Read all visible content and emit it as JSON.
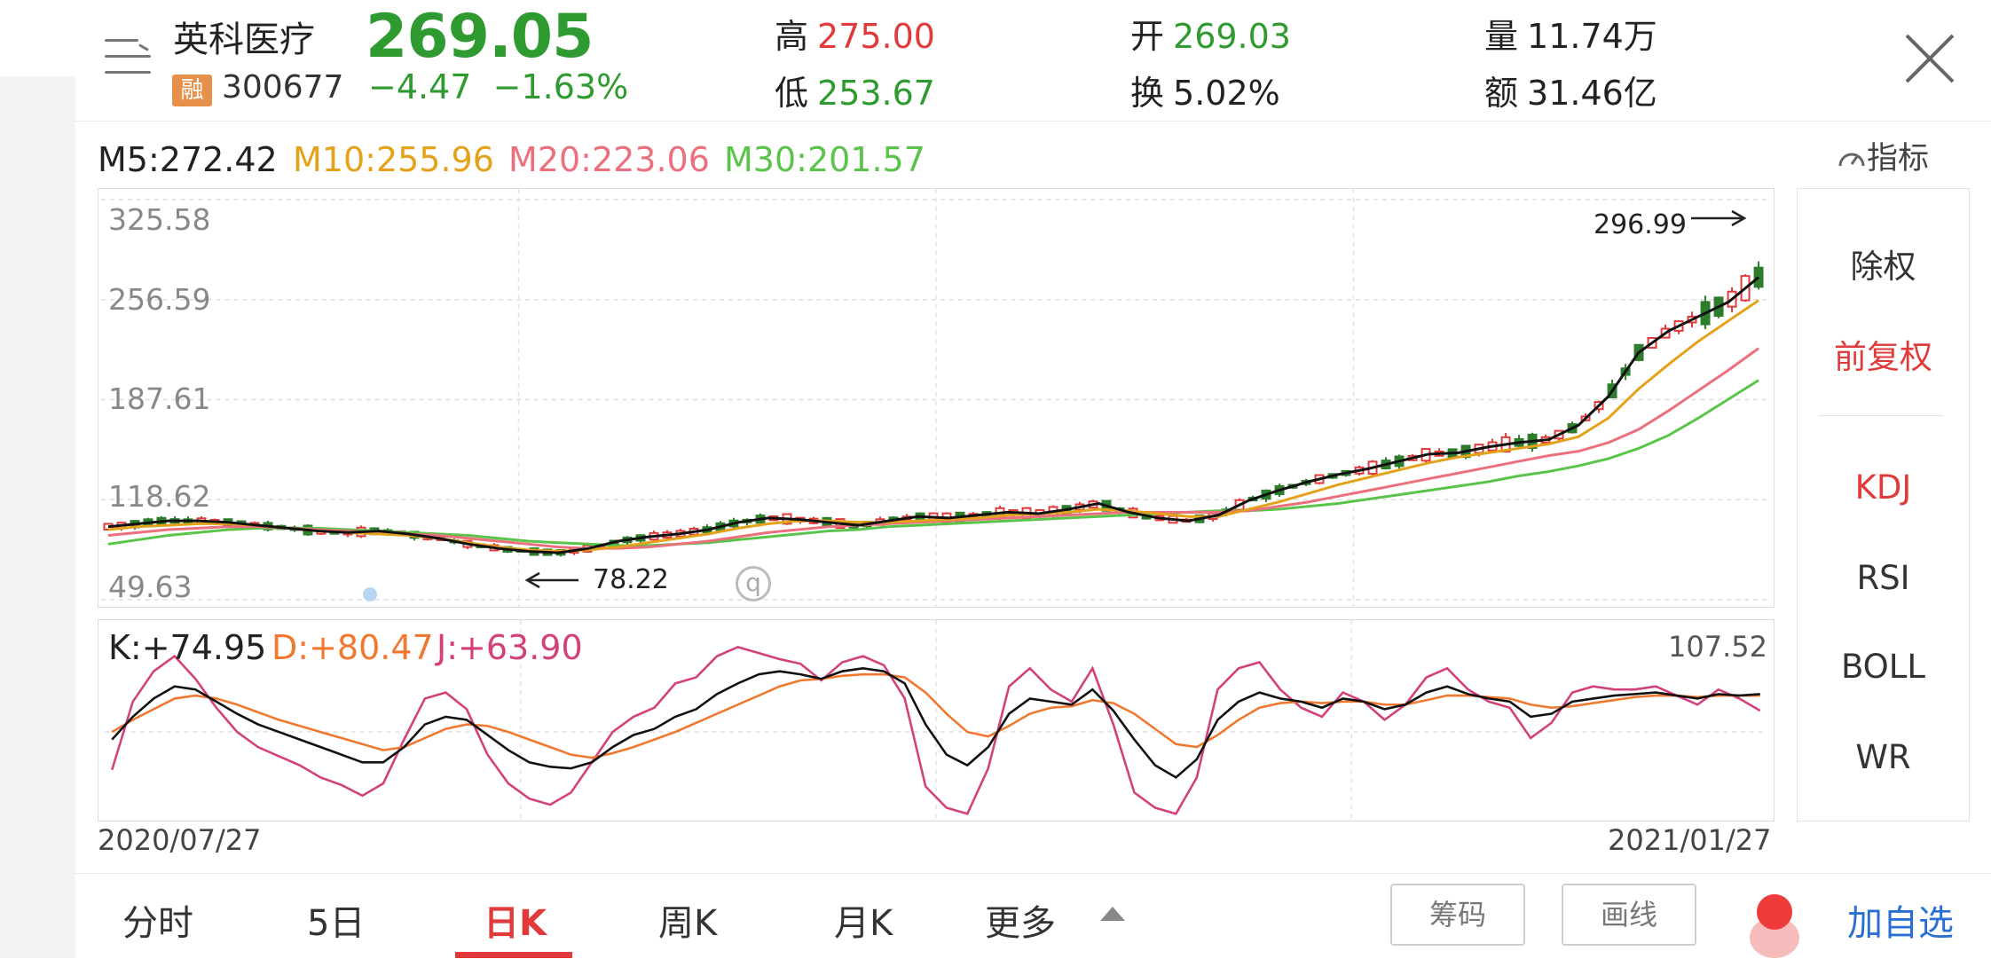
{
  "header": {
    "name": "英科医疗",
    "badge": "融",
    "code": "300677",
    "price": "269.05",
    "change": "−4.47",
    "change_pct": "−1.63%",
    "high_label": "高",
    "high": "275.00",
    "low_label": "低",
    "low": "253.67",
    "open_label": "开",
    "open": "269.03",
    "turnover_label": "换",
    "turnover": "5.02%",
    "volume_label": "量",
    "volume": "11.74万",
    "amount_label": "额",
    "amount": "31.46亿",
    "colors": {
      "up": "#e03a3a",
      "down": "#2f9a2f"
    }
  },
  "ma_legend": {
    "m5": "M5:272.42",
    "m10": "M10:255.96",
    "m20": "M20:223.06",
    "m30": "M30:201.57"
  },
  "indicator_button": "指标",
  "main_chart": {
    "y_ticks": [
      "325.58",
      "256.59",
      "187.61",
      "118.62",
      "49.63"
    ],
    "max_annotation": "296.99",
    "min_annotation": "78.22",
    "watermark": "q"
  },
  "kdj": {
    "k": "K:+74.95",
    "d": "D:+80.47",
    "j": "J:+63.90",
    "max": "107.52"
  },
  "dates": {
    "start": "2020/07/27",
    "end": "2021/01/27"
  },
  "side_panel": {
    "items": [
      "除权",
      "前复权",
      "KDJ",
      "RSI",
      "BOLL",
      "WR"
    ]
  },
  "tabs": [
    "分时",
    "5日",
    "日K",
    "周K",
    "月K",
    "更多"
  ],
  "active_tab": "日K",
  "buttons": {
    "chips": "筹码",
    "draw": "画线",
    "add_watch": "加自选"
  },
  "chart_data": [
    {
      "type": "candlestick",
      "x_range": [
        "2020/07/27",
        "2021/01/27"
      ],
      "ylim": [
        49.63,
        325.58
      ],
      "y_ticks": [
        325.58,
        256.59,
        187.61,
        118.62,
        49.63
      ],
      "series": [
        {
          "name": "M5",
          "value": 272.42,
          "color": "#111111",
          "values": [
            100,
            102,
            104,
            104,
            103,
            101,
            99,
            97,
            96,
            97,
            95,
            92,
            88,
            85,
            83,
            82,
            85,
            90,
            93,
            95,
            98,
            103,
            106,
            105,
            103,
            101,
            104,
            107,
            106,
            108,
            110,
            109,
            112,
            116,
            110,
            106,
            104,
            108,
            118,
            125,
            131,
            136,
            140,
            145,
            150,
            151,
            155,
            158,
            160,
            170,
            190,
            220,
            235,
            245,
            255,
            272
          ]
        },
        {
          "name": "M10",
          "value": 255.96,
          "color": "#e3a21a",
          "values": [
            98,
            100,
            101,
            102,
            102,
            101,
            99,
            97,
            96,
            95,
            94,
            92,
            89,
            86,
            84,
            83,
            84,
            86,
            89,
            92,
            95,
            99,
            102,
            104,
            104,
            103,
            103,
            104,
            105,
            106,
            108,
            109,
            110,
            112,
            111,
            109,
            107,
            107,
            112,
            117,
            123,
            129,
            134,
            139,
            144,
            148,
            151,
            154,
            157,
            162,
            175,
            195,
            212,
            228,
            242,
            256
          ]
        },
        {
          "name": "M20",
          "value": 223.06,
          "color": "#ec6f7d",
          "values": [
            94,
            96,
            98,
            99,
            100,
            100,
            99,
            98,
            97,
            96,
            95,
            94,
            92,
            90,
            88,
            86,
            85,
            85,
            86,
            88,
            90,
            93,
            96,
            98,
            100,
            101,
            102,
            103,
            104,
            105,
            106,
            107,
            108,
            109,
            110,
            110,
            110,
            110,
            111,
            114,
            117,
            121,
            125,
            129,
            133,
            137,
            141,
            145,
            149,
            152,
            158,
            167,
            180,
            194,
            208,
            223
          ]
        },
        {
          "name": "M30",
          "value": 201.57,
          "color": "#5ac44a",
          "values": [
            88,
            91,
            94,
            96,
            98,
            99,
            99,
            99,
            98,
            97,
            96,
            95,
            94,
            92,
            90,
            89,
            88,
            87,
            87,
            88,
            89,
            91,
            93,
            95,
            97,
            98,
            100,
            101,
            102,
            103,
            104,
            105,
            106,
            107,
            108,
            109,
            110,
            111,
            111,
            112,
            114,
            116,
            119,
            122,
            125,
            128,
            131,
            135,
            138,
            142,
            147,
            154,
            163,
            175,
            188,
            201
          ]
        }
      ],
      "annotations": {
        "max": 296.99,
        "min": 78.22
      }
    },
    {
      "type": "line",
      "title": "KDJ",
      "ylim": [
        -5,
        107.52
      ],
      "series": [
        {
          "name": "K",
          "value": 74.95,
          "color": "#111111",
          "values": [
            45,
            60,
            72,
            80,
            78,
            70,
            62,
            55,
            50,
            45,
            40,
            35,
            30,
            30,
            40,
            55,
            60,
            58,
            48,
            38,
            30,
            27,
            26,
            30,
            40,
            48,
            52,
            60,
            65,
            75,
            82,
            88,
            90,
            88,
            85,
            90,
            92,
            90,
            82,
            55,
            35,
            28,
            40,
            62,
            72,
            70,
            68,
            78,
            64,
            45,
            28,
            20,
            32,
            58,
            70,
            76,
            72,
            70,
            66,
            72,
            70,
            65,
            68,
            76,
            80,
            75,
            72,
            70,
            60,
            62,
            70,
            72,
            74,
            75,
            76,
            74,
            72,
            75,
            74,
            75
          ]
        },
        {
          "name": "D",
          "value": 80.47,
          "color": "#f07830",
          "values": [
            50,
            58,
            65,
            72,
            74,
            72,
            68,
            63,
            58,
            54,
            50,
            46,
            42,
            38,
            40,
            46,
            52,
            55,
            54,
            50,
            45,
            40,
            35,
            33,
            36,
            40,
            45,
            50,
            56,
            62,
            68,
            74,
            80,
            84,
            85,
            87,
            88,
            88,
            86,
            76,
            62,
            50,
            47,
            54,
            62,
            66,
            67,
            71,
            69,
            62,
            52,
            42,
            40,
            48,
            58,
            66,
            69,
            70,
            69,
            70,
            70,
            68,
            68,
            71,
            74,
            74,
            73,
            72,
            68,
            66,
            67,
            69,
            71,
            73,
            74,
            74,
            73,
            74,
            74,
            74
          ]
        },
        {
          "name": "J",
          "value": 63.9,
          "color": "#d2417a",
          "values": [
            25,
            70,
            90,
            100,
            85,
            66,
            50,
            40,
            34,
            28,
            20,
            15,
            8,
            16,
            45,
            72,
            76,
            65,
            35,
            16,
            6,
            2,
            10,
            30,
            50,
            60,
            66,
            82,
            86,
            100,
            106,
            102,
            98,
            95,
            84,
            96,
            100,
            94,
            72,
            14,
            0,
            -4,
            26,
            80,
            92,
            78,
            70,
            92,
            55,
            10,
            0,
            -4,
            20,
            78,
            92,
            96,
            78,
            66,
            60,
            76,
            70,
            58,
            68,
            86,
            92,
            78,
            70,
            66,
            46,
            56,
            76,
            80,
            78,
            78,
            80,
            74,
            68,
            78,
            72,
            64
          ]
        }
      ]
    }
  ]
}
